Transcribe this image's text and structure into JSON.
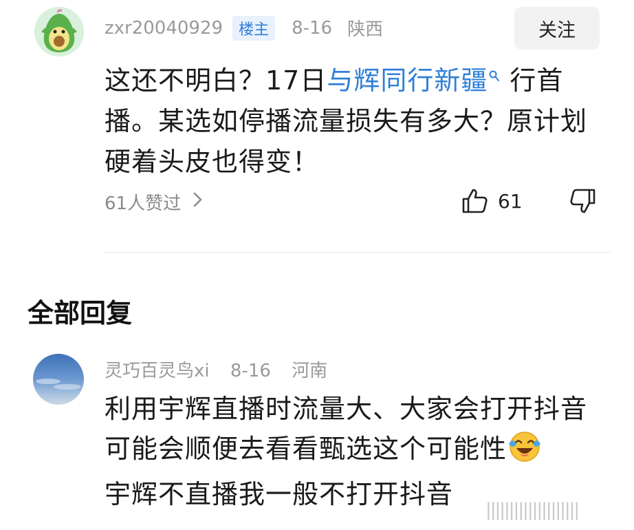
{
  "main_comment": {
    "username": "zxr20040929",
    "badge": "楼主",
    "date": "8-16",
    "location": "陕西",
    "follow_label": "关注",
    "text_before": "这还不明白？17日",
    "link_text": "与辉同行新疆",
    "text_after": "行首播。某选如停播流量损失有多大？原计划硬着头皮也得变！",
    "likers_text": "61人赞过",
    "like_count": "61"
  },
  "section_title": "全部回复",
  "reply": {
    "username": "灵巧百灵鸟xi",
    "date": "8-16",
    "location": "河南",
    "text_before_emoji": "利用宇辉直播时流量大、大家会打开抖音可能会顺便去看看甄选这个可能性",
    "text_after_emoji": "宇辉不直播我一般不打开抖音"
  },
  "icons": {
    "search": "search-icon",
    "chevron": "chevron-right-icon",
    "like": "thumbs-up-icon",
    "dislike": "thumbs-down-icon",
    "emoji": "laughing-crying-emoji-icon"
  },
  "colors": {
    "link": "#2f7fd8",
    "badge_bg": "#e8f1fc"
  }
}
